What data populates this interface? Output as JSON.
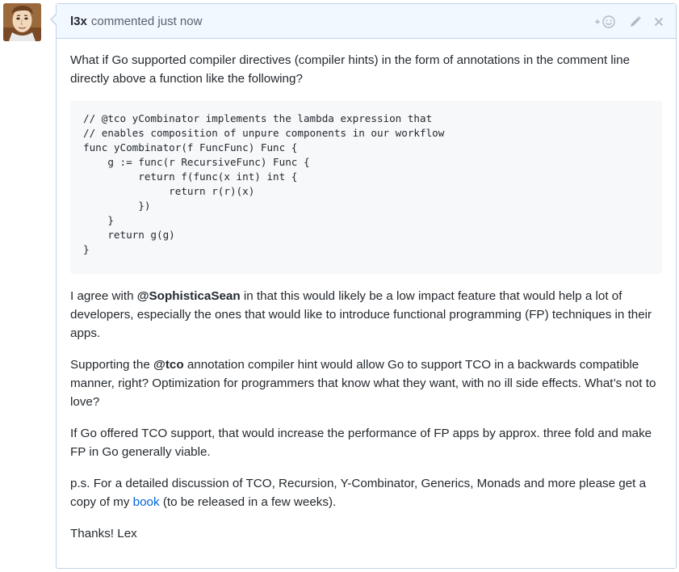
{
  "comment": {
    "author": "l3x",
    "meta": "commented just now",
    "paragraph1": "What if Go supported compiler directives (compiler hints) in the form of annotations in the comment line directly above a function like the following?",
    "code_lines": [
      "// @tco yCombinator implements the lambda expression that",
      "// enables composition of unpure components in our workflow",
      "func yCombinator(f FuncFunc) Func {",
      "    g := func(r RecursiveFunc) Func {",
      "         return f(func(x int) int {",
      "              return r(r)(x)",
      "         })",
      "    }",
      "    return g(g)",
      "}"
    ],
    "paragraph2": {
      "before": "I agree with ",
      "mention": "@SophisticaSean",
      "after": " in that this would likely be a low impact feature that would help a lot of developers, especially the ones that would like to introduce functional programming (FP) techniques in their apps."
    },
    "paragraph3": {
      "before": "Supporting the ",
      "mention": "@tco",
      "after": " annotation compiler hint would allow Go to support TCO in a backwards compatible manner, right? Optimization for programmers that know what they want, with no ill side effects. What’s not to love?"
    },
    "paragraph4": "If Go offered TCO support, that would increase the performance of FP apps by approx. three fold and make FP in Go generally viable.",
    "paragraph5": {
      "before": "p.s. For a detailed discussion of TCO, Recursion, Y-Combinator, Generics, Monads and more please get a copy of my ",
      "link": "book",
      "after": " (to be released in a few weeks)."
    },
    "signoff": "Thanks! Lex"
  },
  "icons": {
    "reaction": "add-reaction-icon",
    "edit": "pencil-icon",
    "delete": "close-icon"
  },
  "colors": {
    "header_bg": "#f1f8ff",
    "border": "#c0d3eb",
    "link": "#0366d6",
    "code_bg": "#f6f8fa"
  }
}
